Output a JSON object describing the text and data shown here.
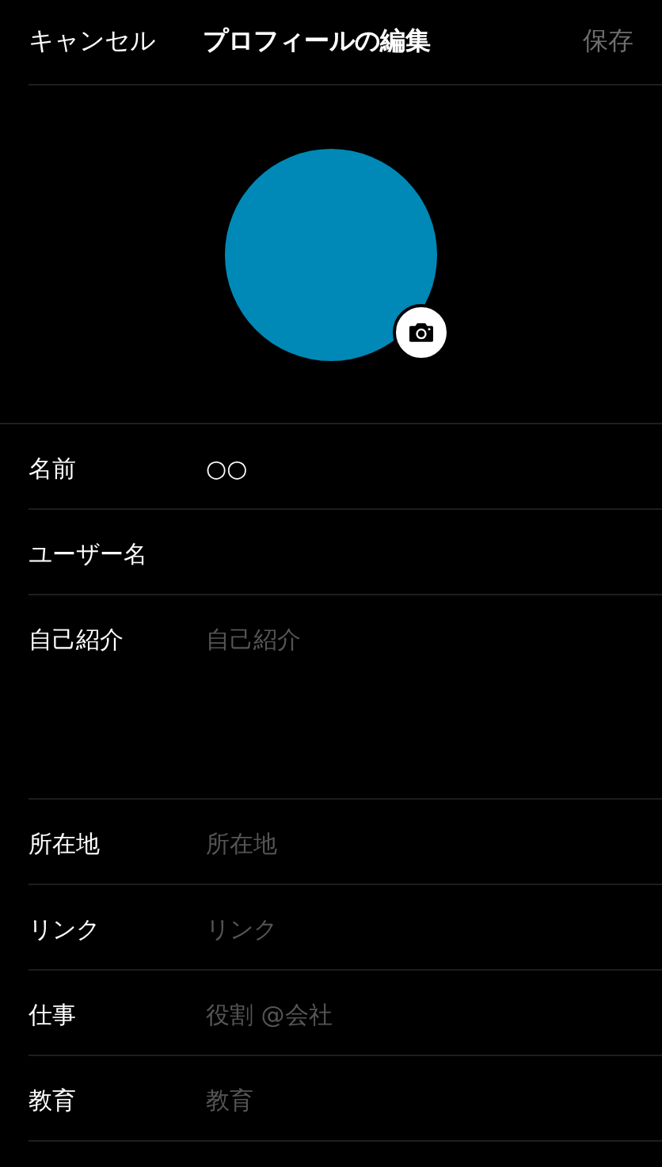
{
  "header": {
    "cancel": "キャンセル",
    "title": "プロフィールの編集",
    "save": {
      "label": "保存",
      "disabled": true
    }
  },
  "avatar": {
    "color": "#0089b6"
  },
  "fields": [
    {
      "label": "名前",
      "kind": "text",
      "value": "○○"
    },
    {
      "label": "ユーザー名",
      "kind": "text"
    },
    {
      "label": "自己紹介",
      "kind": "textarea",
      "placeholder": "自己紹介"
    },
    {
      "label": "所在地",
      "kind": "text",
      "placeholder": "所在地"
    },
    {
      "label": "リンク",
      "kind": "text",
      "placeholder": "リンク"
    },
    {
      "label": "仕事",
      "kind": "text",
      "placeholder": "役割 @会社"
    },
    {
      "label": "教育",
      "kind": "text",
      "placeholder": "教育"
    }
  ]
}
